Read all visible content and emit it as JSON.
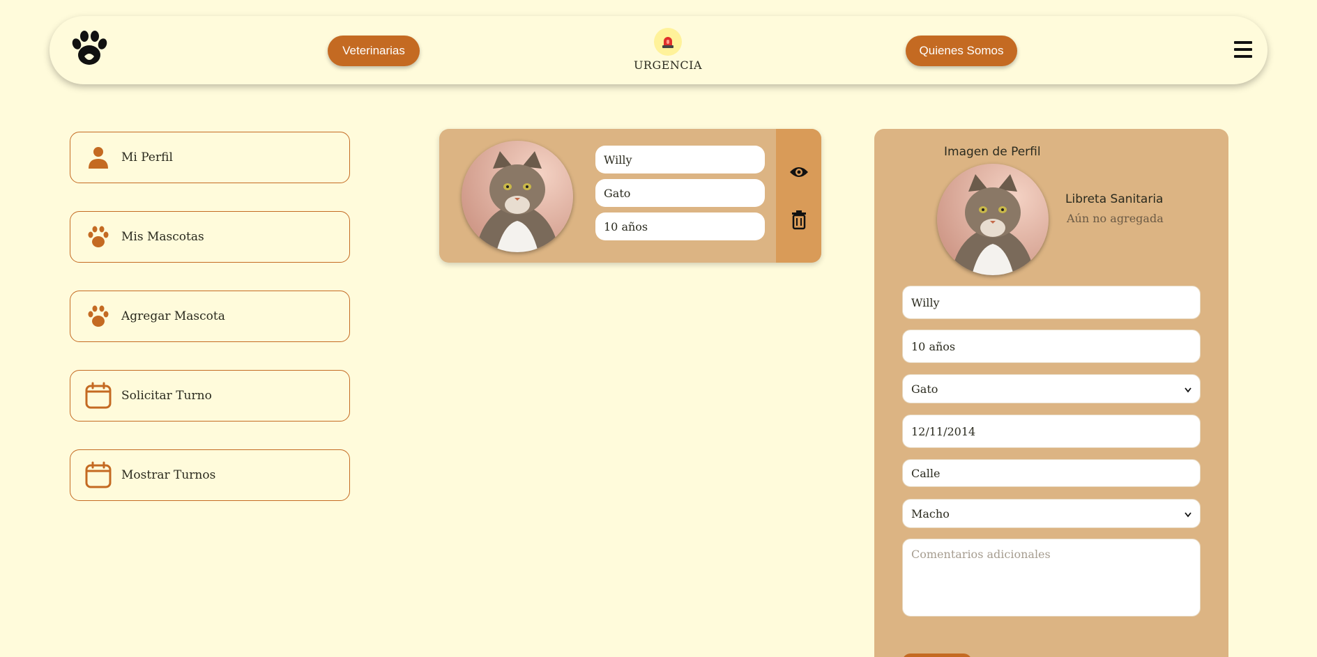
{
  "nav": {
    "veterinarias": "Veterinarias",
    "urgencia": "URGENCIA",
    "quienes_somos": "Quienes Somos"
  },
  "sidebar": {
    "items": [
      {
        "label": "Mi Perfil",
        "icon": "person-icon"
      },
      {
        "label": "Mis Mascotas",
        "icon": "paw-icon"
      },
      {
        "label": "Agregar Mascota",
        "icon": "paw-icon"
      },
      {
        "label": "Solicitar Turno",
        "icon": "calendar-icon"
      },
      {
        "label": "Mostrar Turnos",
        "icon": "calendar-icon"
      }
    ]
  },
  "pet_card": {
    "name": "Willy",
    "species": "Gato",
    "age": "10 años"
  },
  "panel": {
    "image_title": "Imagen de Perfil",
    "libreta_title": "Libreta Sanitaria",
    "libreta_status": "Aún no agregada",
    "name": "Willy",
    "age": "10 años",
    "species": "Gato",
    "birthdate": "12/11/2014",
    "address": "Calle",
    "sex": "Macho",
    "comments_placeholder": "Comentarios adicionales"
  },
  "colors": {
    "background": "#fffbdb",
    "accent": "#c46a22",
    "card": "#dcb483"
  }
}
